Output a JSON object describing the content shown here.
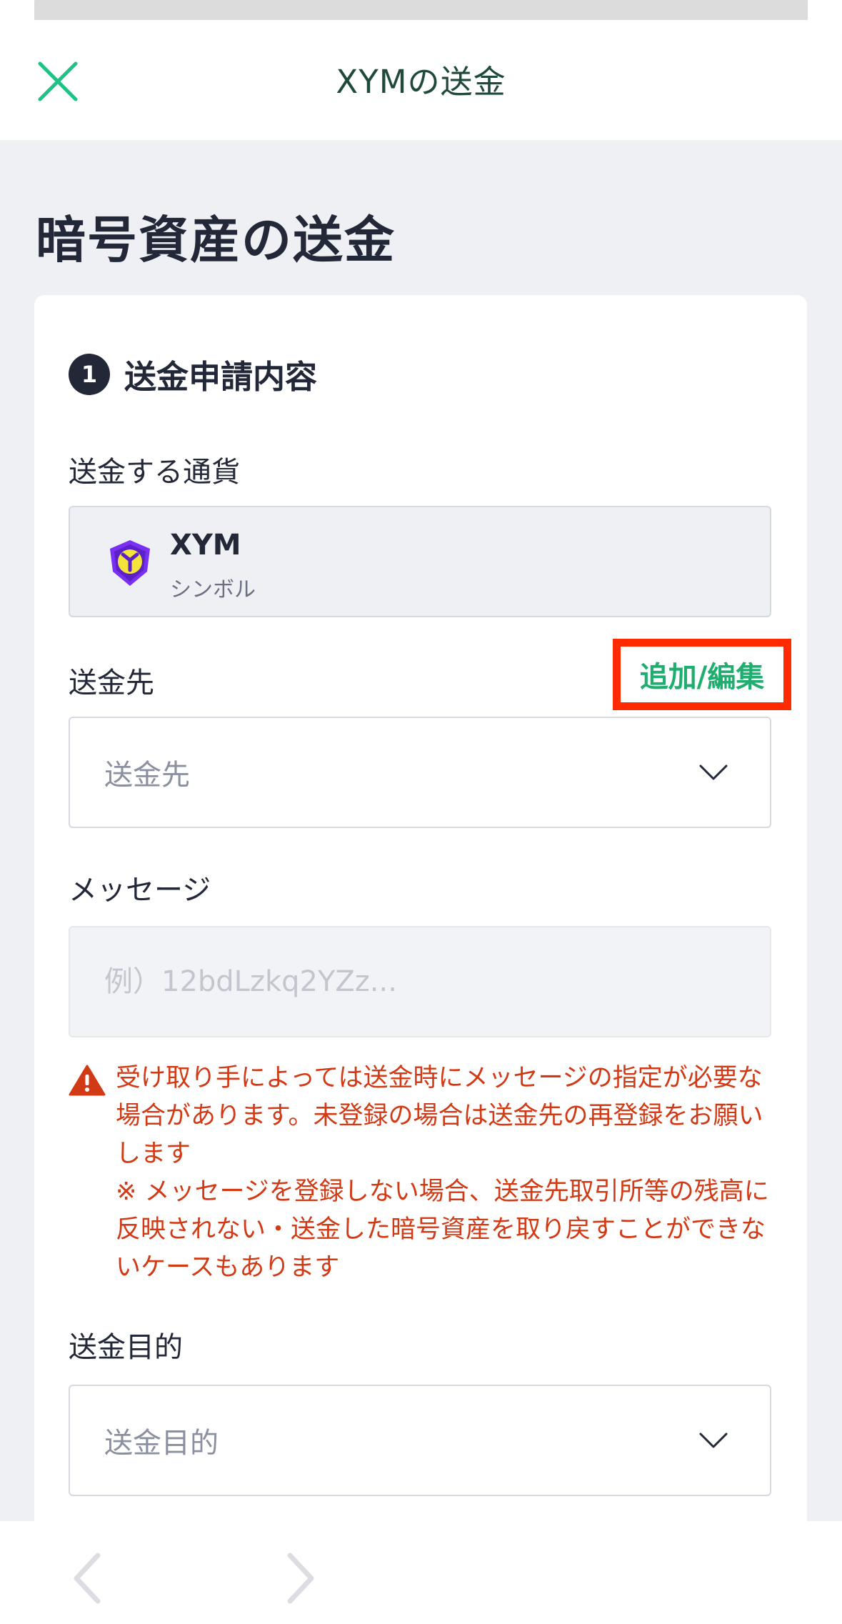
{
  "header": {
    "title": "XYMの送金",
    "close_icon": "close-icon"
  },
  "page": {
    "title": "暗号資産の送金"
  },
  "step": {
    "number": "1",
    "title": "送金申請内容"
  },
  "currency": {
    "label": "送金する通貨",
    "code": "XYM",
    "name": "シンボル",
    "icon": "symbol-coin-icon"
  },
  "destination": {
    "label": "送金先",
    "add_edit_label": "追加/編集",
    "placeholder": "送金先"
  },
  "message": {
    "label": "メッセージ",
    "placeholder": "例）12bdLzkq2YZz..."
  },
  "warning": {
    "line1": "受け取り手によっては送金時にメッセージの指定が必要な場合があります。未登録の場合は送金先の再登録をお願いします",
    "line2": "※ メッセージを登録しない場合、送金先取引所等の残高に反映されない・送金した暗号資産を取り戻すことができないケースもあります"
  },
  "purpose": {
    "label": "送金目的",
    "placeholder": "送金目的"
  },
  "colors": {
    "accent_green": "#1fae6f",
    "warning_red": "#d23a15",
    "highlight_box": "#ff2a00",
    "text_dark": "#232838",
    "symbol_purple": "#6a2ff0"
  }
}
